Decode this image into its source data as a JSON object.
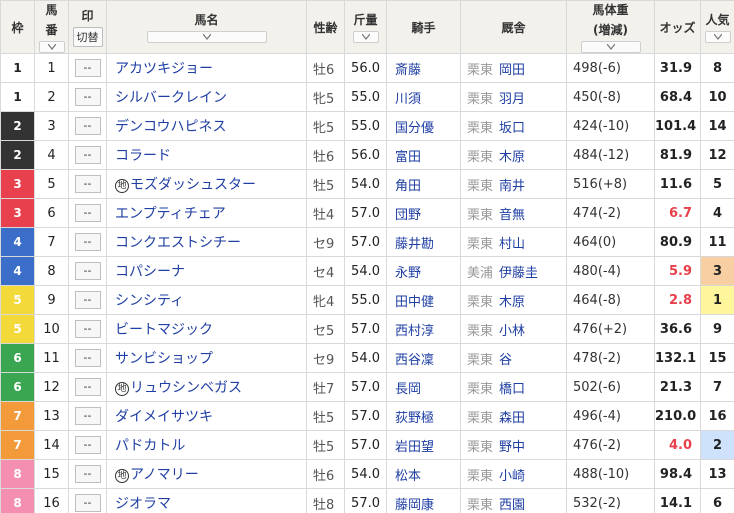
{
  "header": {
    "waku": "枠",
    "umaban_top": "馬",
    "umaban_bottom": "番",
    "mark": "印",
    "kirikae": "切替",
    "horse_name": "馬名",
    "sex_age": "性齢",
    "kinryo": "斤量",
    "jockey": "騎手",
    "stable": "厩舎",
    "weight_top": "馬体重",
    "weight_bottom": "(増減)",
    "odds": "オッズ",
    "popularity": "人気"
  },
  "rows": [
    {
      "waku": "1",
      "waku_class": "w1",
      "num": "1",
      "mark": "--",
      "chi": false,
      "name": "アカツキジョー",
      "sa": "牡6",
      "kin": "56.0",
      "jockey": "斎藤",
      "region": "栗東",
      "trainer": "岡田",
      "weight": "498(-6)",
      "odds": "31.9",
      "hot": false,
      "pop": "8",
      "pop_class": ""
    },
    {
      "waku": "1",
      "waku_class": "w1",
      "num": "2",
      "mark": "--",
      "chi": false,
      "name": "シルバークレイン",
      "sa": "牝5",
      "kin": "55.0",
      "jockey": "川須",
      "region": "栗東",
      "trainer": "羽月",
      "weight": "450(-8)",
      "odds": "68.4",
      "hot": false,
      "pop": "10",
      "pop_class": ""
    },
    {
      "waku": "2",
      "waku_class": "w2",
      "num": "3",
      "mark": "--",
      "chi": false,
      "name": "デンコウハピネス",
      "sa": "牝5",
      "kin": "55.0",
      "jockey": "国分優",
      "region": "栗東",
      "trainer": "坂口",
      "weight": "424(-10)",
      "odds": "101.4",
      "hot": false,
      "pop": "14",
      "pop_class": ""
    },
    {
      "waku": "2",
      "waku_class": "w2",
      "num": "4",
      "mark": "--",
      "chi": false,
      "name": "コラード",
      "sa": "牡6",
      "kin": "56.0",
      "jockey": "富田",
      "region": "栗東",
      "trainer": "木原",
      "weight": "484(-12)",
      "odds": "81.9",
      "hot": false,
      "pop": "12",
      "pop_class": ""
    },
    {
      "waku": "3",
      "waku_class": "w3",
      "num": "5",
      "mark": "--",
      "chi": true,
      "name": "モズダッシュスター",
      "sa": "牡5",
      "kin": "54.0",
      "jockey": "角田",
      "region": "栗東",
      "trainer": "南井",
      "weight": "516(+8)",
      "odds": "11.6",
      "hot": false,
      "pop": "5",
      "pop_class": ""
    },
    {
      "waku": "3",
      "waku_class": "w3",
      "num": "6",
      "mark": "--",
      "chi": false,
      "name": "エンプティチェア",
      "sa": "牡4",
      "kin": "57.0",
      "jockey": "団野",
      "region": "栗東",
      "trainer": "音無",
      "weight": "474(-2)",
      "odds": "6.7",
      "hot": true,
      "pop": "4",
      "pop_class": ""
    },
    {
      "waku": "4",
      "waku_class": "w4",
      "num": "7",
      "mark": "--",
      "chi": false,
      "name": "コンクエストシチー",
      "sa": "セ9",
      "kin": "57.0",
      "jockey": "藤井勘",
      "region": "栗東",
      "trainer": "村山",
      "weight": "464(0)",
      "odds": "80.9",
      "hot": false,
      "pop": "11",
      "pop_class": ""
    },
    {
      "waku": "4",
      "waku_class": "w4",
      "num": "8",
      "mark": "--",
      "chi": false,
      "name": "コパシーナ",
      "sa": "セ4",
      "kin": "54.0",
      "jockey": "永野",
      "region": "美浦",
      "trainer": "伊藤圭",
      "weight": "480(-4)",
      "odds": "5.9",
      "hot": true,
      "pop": "3",
      "pop_class": "p3"
    },
    {
      "waku": "5",
      "waku_class": "w5",
      "num": "9",
      "mark": "--",
      "chi": false,
      "name": "シンシティ",
      "sa": "牝4",
      "kin": "55.0",
      "jockey": "田中健",
      "region": "栗東",
      "trainer": "木原",
      "weight": "464(-8)",
      "odds": "2.8",
      "hot": true,
      "pop": "1",
      "pop_class": "p1"
    },
    {
      "waku": "5",
      "waku_class": "w5",
      "num": "10",
      "mark": "--",
      "chi": false,
      "name": "ビートマジック",
      "sa": "セ5",
      "kin": "57.0",
      "jockey": "西村淳",
      "region": "栗東",
      "trainer": "小林",
      "weight": "476(+2)",
      "odds": "36.6",
      "hot": false,
      "pop": "9",
      "pop_class": ""
    },
    {
      "waku": "6",
      "waku_class": "w6",
      "num": "11",
      "mark": "--",
      "chi": false,
      "name": "サンビショップ",
      "sa": "セ9",
      "kin": "54.0",
      "jockey": "西谷凜",
      "region": "栗東",
      "trainer": "谷",
      "weight": "478(-2)",
      "odds": "132.1",
      "hot": false,
      "pop": "15",
      "pop_class": ""
    },
    {
      "waku": "6",
      "waku_class": "w6",
      "num": "12",
      "mark": "--",
      "chi": true,
      "name": "リュウシンベガス",
      "sa": "牡7",
      "kin": "57.0",
      "jockey": "長岡",
      "region": "栗東",
      "trainer": "橋口",
      "weight": "502(-6)",
      "odds": "21.3",
      "hot": false,
      "pop": "7",
      "pop_class": ""
    },
    {
      "waku": "7",
      "waku_class": "w7",
      "num": "13",
      "mark": "--",
      "chi": false,
      "name": "ダイメイサツキ",
      "sa": "牡5",
      "kin": "57.0",
      "jockey": "荻野極",
      "region": "栗東",
      "trainer": "森田",
      "weight": "496(-4)",
      "odds": "210.0",
      "hot": false,
      "pop": "16",
      "pop_class": ""
    },
    {
      "waku": "7",
      "waku_class": "w7",
      "num": "14",
      "mark": "--",
      "chi": false,
      "name": "パドカトル",
      "sa": "牡5",
      "kin": "57.0",
      "jockey": "岩田望",
      "region": "栗東",
      "trainer": "野中",
      "weight": "476(-2)",
      "odds": "4.0",
      "hot": true,
      "pop": "2",
      "pop_class": "p2"
    },
    {
      "waku": "8",
      "waku_class": "w8",
      "num": "15",
      "mark": "--",
      "chi": true,
      "name": "アノマリー",
      "sa": "牡6",
      "kin": "54.0",
      "jockey": "松本",
      "region": "栗東",
      "trainer": "小崎",
      "weight": "488(-10)",
      "odds": "98.4",
      "hot": false,
      "pop": "13",
      "pop_class": ""
    },
    {
      "waku": "8",
      "waku_class": "w8",
      "num": "16",
      "mark": "--",
      "chi": false,
      "name": "ジオラマ",
      "sa": "牡8",
      "kin": "57.0",
      "jockey": "藤岡康",
      "region": "栗東",
      "trainer": "西園",
      "weight": "532(-2)",
      "odds": "14.1",
      "hot": false,
      "pop": "6",
      "pop_class": ""
    }
  ],
  "chi_mark": "地",
  "colors": {
    "link": "#1f3fa3",
    "hot_odds": "#e8404c",
    "header_bg": "#f3f1ec",
    "waku1": "#ffffff",
    "waku2": "#333333",
    "waku3": "#e8404c",
    "waku4": "#3a6ec8",
    "waku5": "#f3d93a",
    "waku6": "#3aa652",
    "waku7": "#f39a3a",
    "waku8": "#f48fb1"
  },
  "icons": {
    "sort": "chevron-down-icon"
  }
}
